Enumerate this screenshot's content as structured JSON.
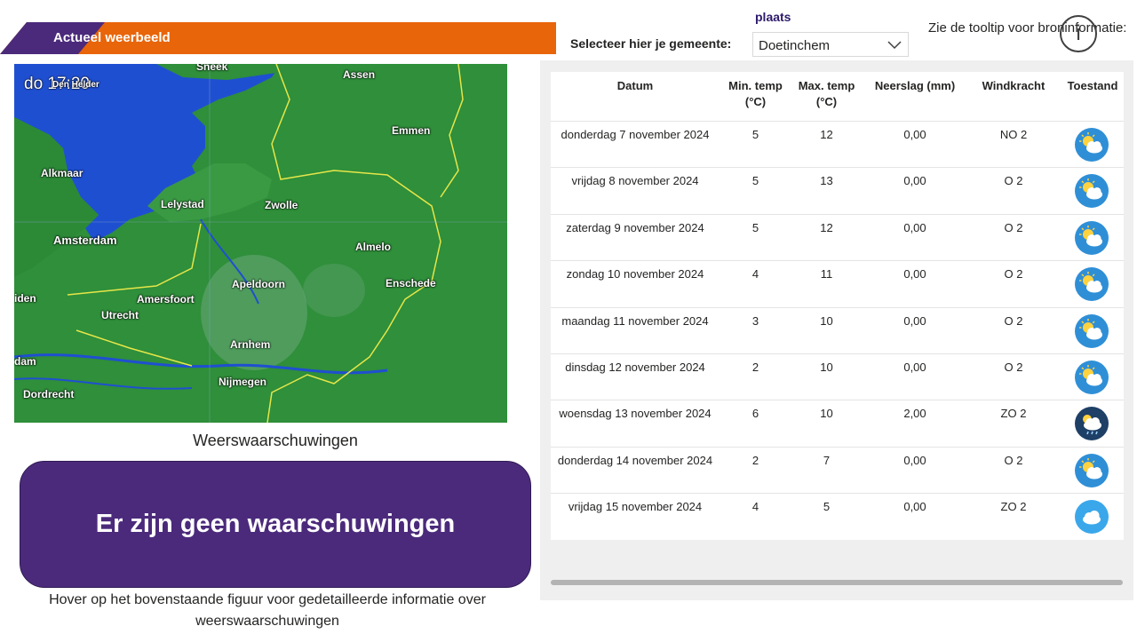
{
  "header": {
    "title": "Actueel weerbeeld"
  },
  "map": {
    "time": "do 17:20",
    "cities": [
      {
        "name": "Assen"
      },
      {
        "name": "Emmen"
      },
      {
        "name": "Alkmaar"
      },
      {
        "name": "Lelystad"
      },
      {
        "name": "Zwolle"
      },
      {
        "name": "Amsterdam"
      },
      {
        "name": "Almelo"
      },
      {
        "name": "Apeldoorn"
      },
      {
        "name": "Enschede"
      },
      {
        "name": "Amersfoort"
      },
      {
        "name": "Utrecht"
      },
      {
        "name": "Arnhem"
      },
      {
        "name": "Nijmegen"
      },
      {
        "name": "Dordrecht"
      },
      {
        "name": "iden"
      },
      {
        "name": "dam"
      },
      {
        "name": "Sneek"
      },
      {
        "name": "Den Helder"
      }
    ]
  },
  "warnings": {
    "title": "Weerswaarschuwingen",
    "message": "Er zijn geen waarschuwingen",
    "hover_note": "Hover op het bovenstaande figuur voor gedetailleerde informatie over weerswaarschuwingen"
  },
  "location": {
    "place_label": "plaats",
    "select_label": "Selecteer hier je gemeente:",
    "selected": "Doetinchem",
    "tooltip_text": "Zie de tooltip voor broninformatie:",
    "info_icon": "i"
  },
  "table": {
    "headers": {
      "date": "Datum",
      "min_temp": "Min. temp (°C)",
      "max_temp": "Max. temp (°C)",
      "precip": "Neerslag (mm)",
      "wind": "Windkracht",
      "state": "Toestand"
    },
    "rows": [
      {
        "date": "donderdag 7 november 2024",
        "min": "5",
        "max": "12",
        "precip": "0,00",
        "wind": "NO 2",
        "icon": "sun-cloud-icon"
      },
      {
        "date": "vrijdag 8 november 2024",
        "min": "5",
        "max": "13",
        "precip": "0,00",
        "wind": "O 2",
        "icon": "sun-cloud-icon"
      },
      {
        "date": "zaterdag 9 november 2024",
        "min": "5",
        "max": "12",
        "precip": "0,00",
        "wind": "O 2",
        "icon": "sun-cloud-icon"
      },
      {
        "date": "zondag 10 november 2024",
        "min": "4",
        "max": "11",
        "precip": "0,00",
        "wind": "O 2",
        "icon": "sun-cloud-icon"
      },
      {
        "date": "maandag 11 november 2024",
        "min": "3",
        "max": "10",
        "precip": "0,00",
        "wind": "O 2",
        "icon": "sun-cloud-icon"
      },
      {
        "date": "dinsdag 12 november 2024",
        "min": "2",
        "max": "10",
        "precip": "0,00",
        "wind": "O 2",
        "icon": "sun-cloud-icon"
      },
      {
        "date": "woensdag 13 november 2024",
        "min": "6",
        "max": "10",
        "precip": "2,00",
        "wind": "ZO 2",
        "icon": "rain-cloud-icon"
      },
      {
        "date": "donderdag 14 november 2024",
        "min": "2",
        "max": "7",
        "precip": "0,00",
        "wind": "O 2",
        "icon": "sun-cloud-icon"
      },
      {
        "date": "vrijdag 15 november 2024",
        "min": "4",
        "max": "5",
        "precip": "0,00",
        "wind": "ZO 2",
        "icon": "cloud-icon"
      }
    ]
  },
  "colors": {
    "banner_orange": "#e8650a",
    "banner_purple": "#4b2a7b",
    "warning_box": "#4b2a7b",
    "map_land": "#2e8b3a",
    "map_water": "#1f4fd1"
  }
}
